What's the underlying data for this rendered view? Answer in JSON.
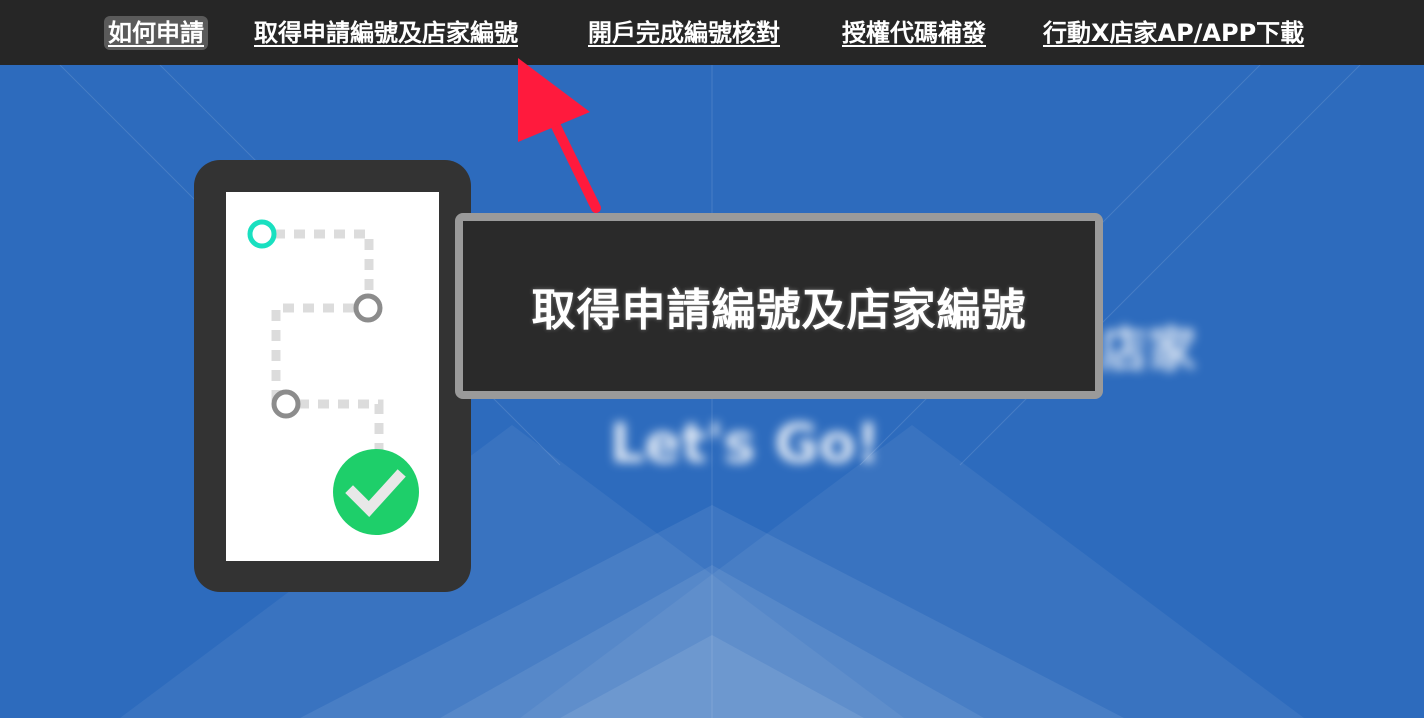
{
  "nav": {
    "items": [
      {
        "label": "如何申請"
      },
      {
        "label": "取得申請編號及店家編號"
      },
      {
        "label": "開戶完成編號核對"
      },
      {
        "label": "授權代碼補發"
      },
      {
        "label": "行動X店家AP/APP下載"
      }
    ]
  },
  "hero": {
    "blurred_line1": "店家",
    "blurred_line2": "Let's Go!"
  },
  "tooltip": {
    "text": "取得申請編號及店家編號"
  },
  "colors": {
    "nav_bg": "#262626",
    "hero_bg": "#2d6bbd",
    "arrow": "#ff1a3d",
    "route_start": "#19e0c0",
    "check": "#1ecf6a"
  },
  "icons": {
    "route_icon": "route-progress-icon",
    "check_icon": "check-circle-icon"
  }
}
